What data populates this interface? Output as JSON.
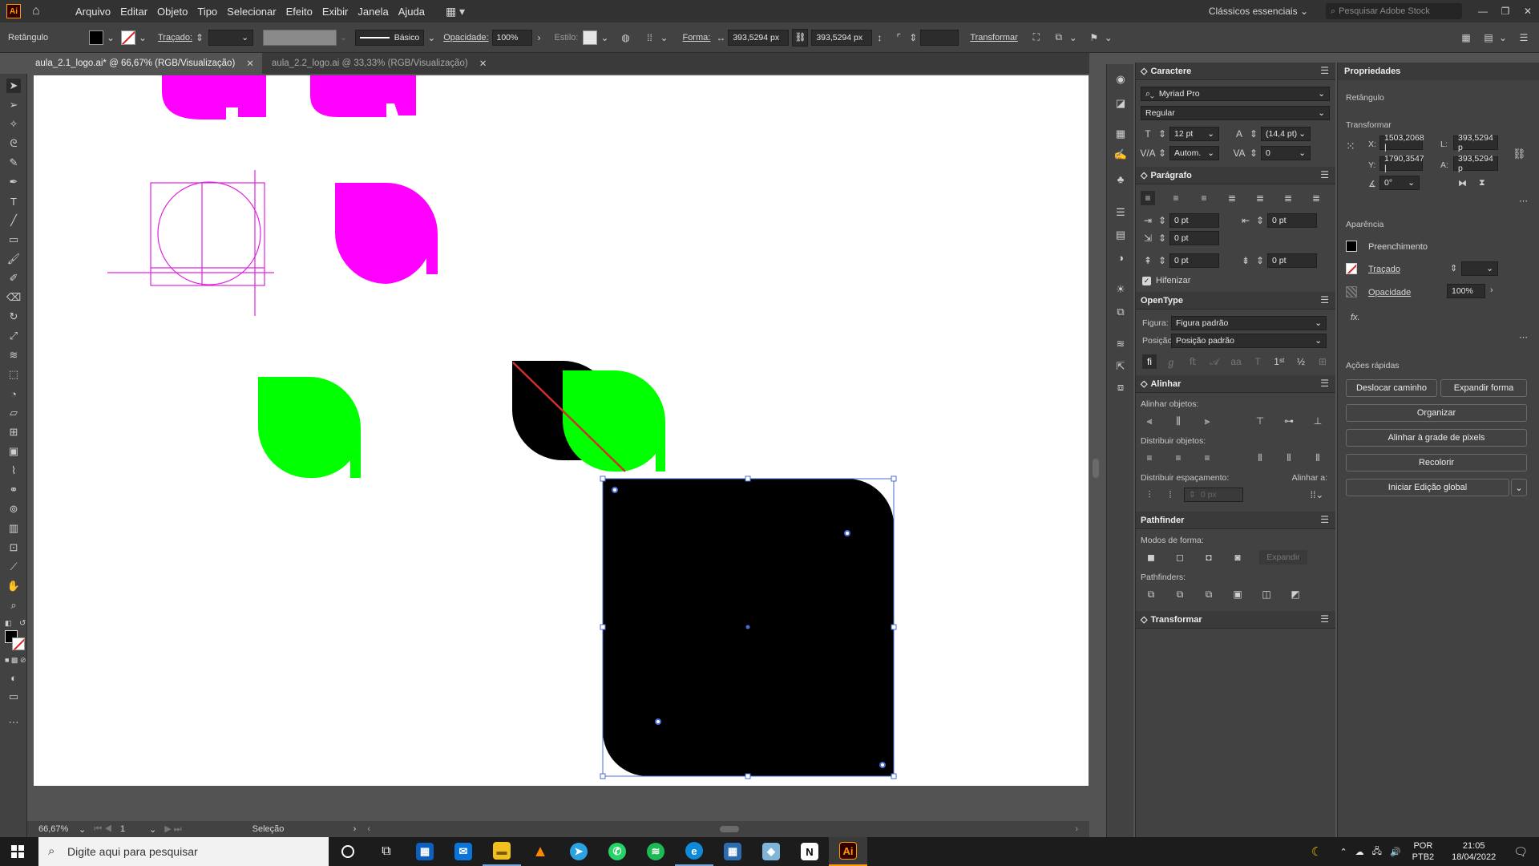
{
  "app": {
    "logo": "Ai",
    "workspace": "Clássicos essenciais",
    "stock_search_placeholder": "Pesquisar Adobe Stock"
  },
  "menu": [
    "Arquivo",
    "Editar",
    "Objeto",
    "Tipo",
    "Selecionar",
    "Efeito",
    "Exibir",
    "Janela",
    "Ajuda"
  ],
  "control": {
    "object_type": "Retângulo",
    "stroke_label": "Traçado:",
    "brush": "Básico",
    "opacity_label": "Opacidade:",
    "opacity": "100%",
    "style_label": "Estilo:",
    "shape_label": "Forma:",
    "width": "393,5294 px",
    "height": "393,5294 px",
    "transform_label": "Transformar"
  },
  "tabs": [
    {
      "label": "aula_2.1_logo.ai* @ 66,67% (RGB/Visualização)"
    },
    {
      "label": "aula_2.2_logo.ai @ 33,33% (RGB/Visualização)"
    }
  ],
  "status": {
    "zoom": "66,67%",
    "page": "1",
    "tool": "Seleção"
  },
  "character": {
    "title": "Caractere",
    "font": "Myriad Pro",
    "style": "Regular",
    "size": "12 pt",
    "leading": "(14,4 pt)",
    "kerning": "Autom.",
    "tracking": "0"
  },
  "paragraph": {
    "title": "Parágrafo",
    "left_indent": "0 pt",
    "right_indent": "0 pt",
    "first_indent": "0 pt",
    "space_before": "0 pt",
    "space_after": "0 pt",
    "hyphenate": "Hifenizar"
  },
  "opentype": {
    "title": "OpenType",
    "figure_label": "Figura:",
    "figure": "Figura padrão",
    "position_label": "Posição:",
    "position": "Posição padrão"
  },
  "align": {
    "title": "Alinhar",
    "align_objects": "Alinhar objetos:",
    "distribute_objects": "Distribuir objetos:",
    "distribute_spacing": "Distribuir espaçamento:",
    "align_to": "Alinhar a:",
    "spacing_value": "0 px"
  },
  "pathfinder": {
    "title": "Pathfinder",
    "shape_modes": "Modos de forma:",
    "expand": "Expandir",
    "pathfinders": "Pathfinders:"
  },
  "transform_panel": {
    "title": "Transformar"
  },
  "properties": {
    "title": "Propriedades",
    "object": "Retângulo",
    "transform": "Transformar",
    "x_label": "X:",
    "x": "1503,2068 |",
    "y_label": "Y:",
    "y": "1790,3547 |",
    "w_label": "L:",
    "w": "393,5294 p",
    "h_label": "A:",
    "h": "393,5294 p",
    "angle": "0°",
    "appearance": "Aparência",
    "fill": "Preenchimento",
    "stroke": "Traçado",
    "opacity_label": "Opacidade",
    "opacity": "100%",
    "fx": "fx.",
    "quick_actions": "Ações rápidas",
    "btn_offset_path": "Deslocar caminho",
    "btn_expand_shape": "Expandir forma",
    "btn_arrange": "Organizar",
    "btn_pixel_grid": "Alinhar à grade de pixels",
    "btn_recolor": "Recolorir",
    "btn_global_edit": "Iniciar Edição global"
  },
  "taskbar": {
    "search_placeholder": "Digite aqui para pesquisar",
    "lang_top": "POR",
    "lang_bottom": "PTB2",
    "time": "21:05",
    "date": "18/04/2022"
  },
  "colors": {
    "magenta": "#ff00ff",
    "green": "#00ff00",
    "black": "#000000",
    "selection": "#4a6bd6",
    "diag_line": "#d0302a"
  }
}
